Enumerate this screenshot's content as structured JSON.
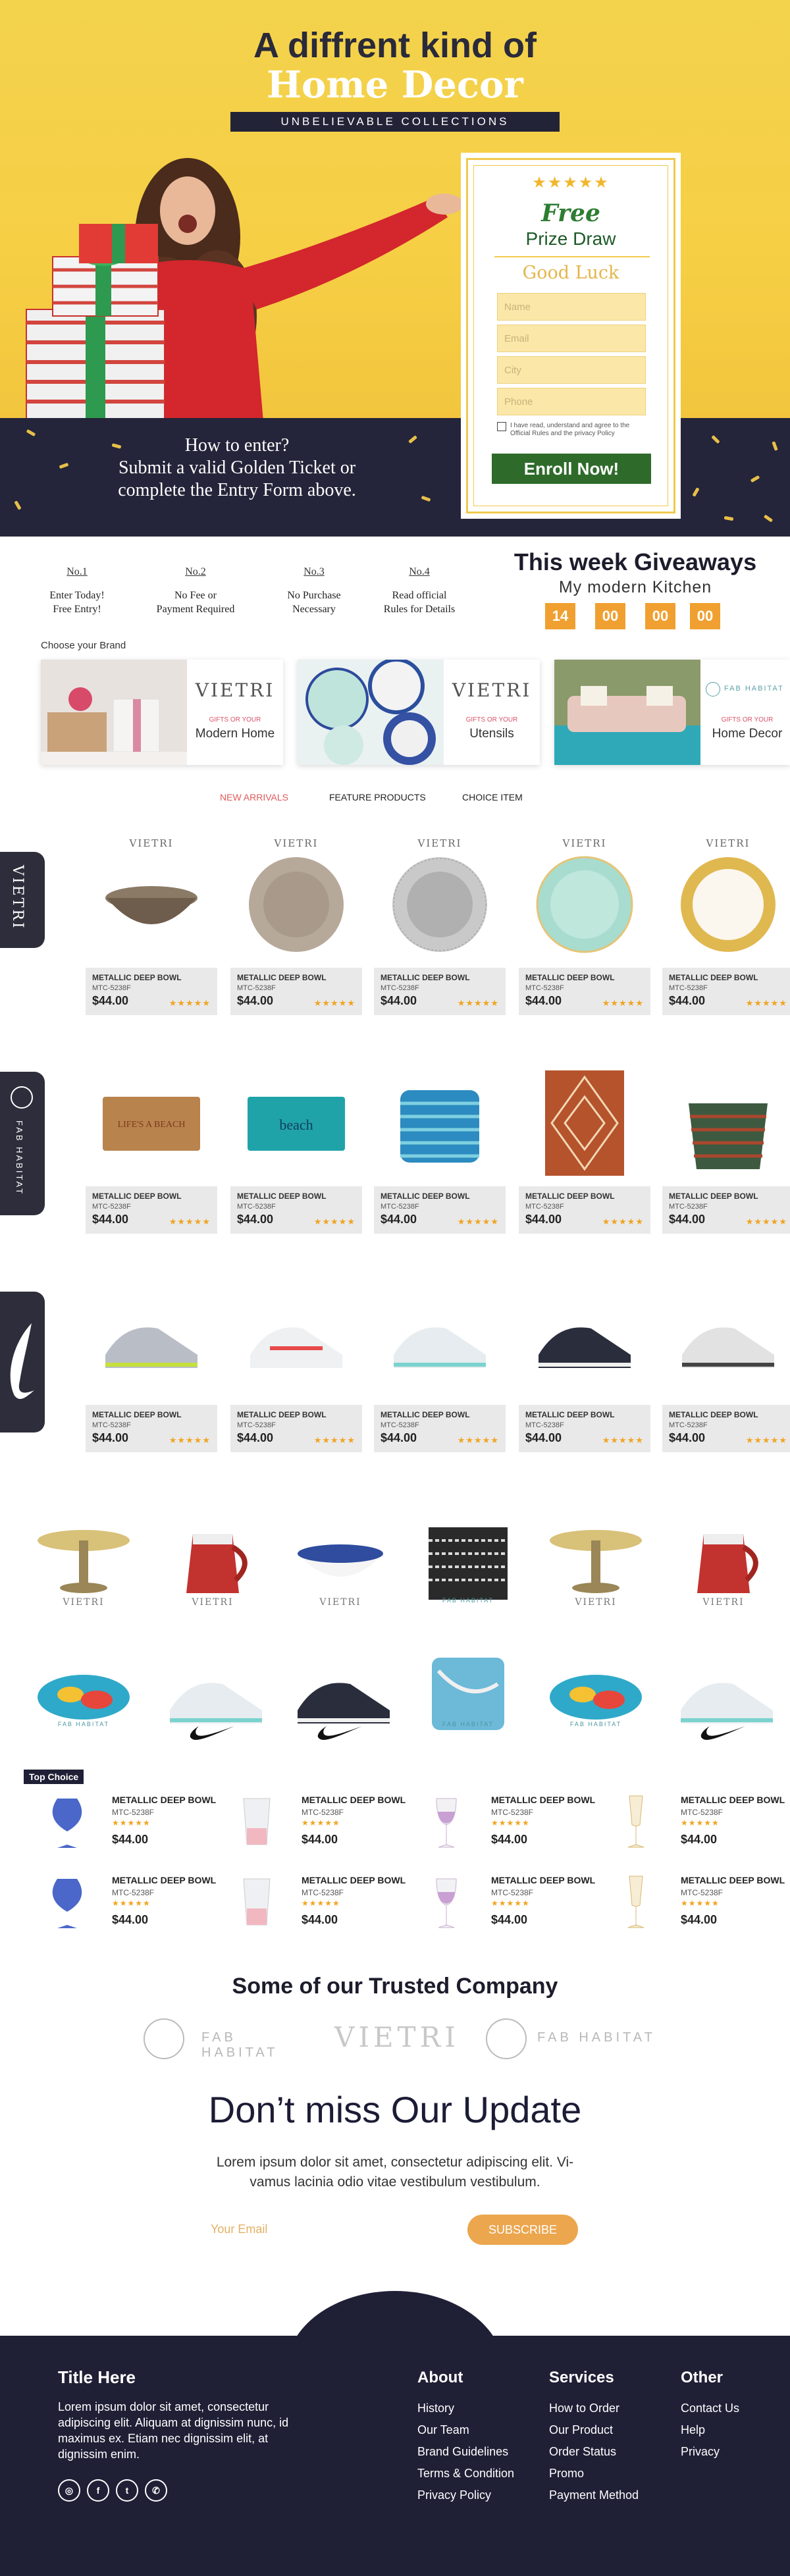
{
  "hero": {
    "title_line1": "A diffrent kind of",
    "title_line2": "Home Decor",
    "banner": "UNBELIEVABLE COLLECTIONS",
    "how_to_enter": "How to enter?",
    "how_line2": "Submit a valid Golden Ticket or",
    "how_line3": "complete the Entry Form above."
  },
  "form": {
    "stars": "★★★★★",
    "free": "Free",
    "prize": "Prize Draw",
    "good_luck": "Good Luck",
    "fields": [
      {
        "placeholder": "Name"
      },
      {
        "placeholder": "Email"
      },
      {
        "placeholder": "City"
      },
      {
        "placeholder": "Phone"
      }
    ],
    "agree_text": "I have read, understand and agree to the Official Rules and the privacy Policy",
    "submit_label": "Enroll Now!"
  },
  "steps": [
    {
      "num": "No.1",
      "line1": "Enter Today!",
      "line2": "Free Entry!"
    },
    {
      "num": "No.2",
      "line1": "No Fee or",
      "line2": "Payment Required"
    },
    {
      "num": "No.3",
      "line1": "No Purchase",
      "line2": "Necessary"
    },
    {
      "num": "No.4",
      "line1": "Read official",
      "line2": "Rules for Details"
    }
  ],
  "giveaway": {
    "title": "This week Giveaways",
    "subtitle": "My modern Kitchen",
    "countdown": [
      "14",
      "00",
      "00",
      "00"
    ]
  },
  "brands": {
    "heading": "Choose your Brand",
    "cards": [
      {
        "logo": "VIETRI",
        "tagline": "GIFTS OR YOUR",
        "name": "Modern Home"
      },
      {
        "logo": "VIETRI",
        "tagline": "GIFTS OR YOUR",
        "name": "Utensils"
      },
      {
        "logo": "FAB HABITAT",
        "tagline": "GIFTS OR YOUR",
        "name": "Home Decor"
      }
    ]
  },
  "tabs": [
    "NEW ARRIVALS",
    "FEATURE PRODUCTS",
    "CHOICE ITEM"
  ],
  "side_tabs": [
    "VIETRI",
    "FAB HABITAT",
    "NIKE"
  ],
  "product": {
    "name": "METALLIC DEEP BOWL",
    "sku": "MTC-5238F",
    "price": "$44.00",
    "stars": "★★★★★",
    "brand_logo": "VIETRI"
  },
  "gallery": {
    "vietri": "VIETRI",
    "fab": "FAB HABITAT"
  },
  "top_choice": {
    "label": "Top Choice"
  },
  "trusted": {
    "title": "Some of our Trusted Company",
    "logos": [
      "FAB HABITAT",
      "VIETRI",
      "FAB HABITAT"
    ]
  },
  "newsletter": {
    "title": "Don’t miss Our Update",
    "text": "Lorem ipsum dolor sit amet, consectetur adipiscing elit. Vi-vamus lacinia odio vitae vestibulum vestibulum.",
    "email_placeholder": "Your Email",
    "subscribe_label": "SUBSCRIBE"
  },
  "footer": {
    "title": "Title Here",
    "text": "Lorem ipsum dolor sit amet, consectetur adipiscing elit. Aliquam at dignissim nunc, id maximus ex. Etiam nec dignissim elit, at dignissim enim.",
    "about": {
      "heading": "About",
      "links": [
        "History",
        "Our Team",
        "Brand Guidelines",
        "Terms & Condition",
        "Privacy Policy"
      ]
    },
    "services": {
      "heading": "Services",
      "links": [
        "How to Order",
        "Our Product",
        "Order Status",
        "Promo",
        "Payment Method"
      ]
    },
    "other": {
      "heading": "Other",
      "links": [
        "Contact Us",
        "Help",
        "Privacy"
      ]
    }
  },
  "colors": {
    "hero_yellow": "#f3d24c",
    "navy": "#1f1f36",
    "orange": "#f0a030",
    "green": "#2e6b2a",
    "star": "#f0a520"
  }
}
